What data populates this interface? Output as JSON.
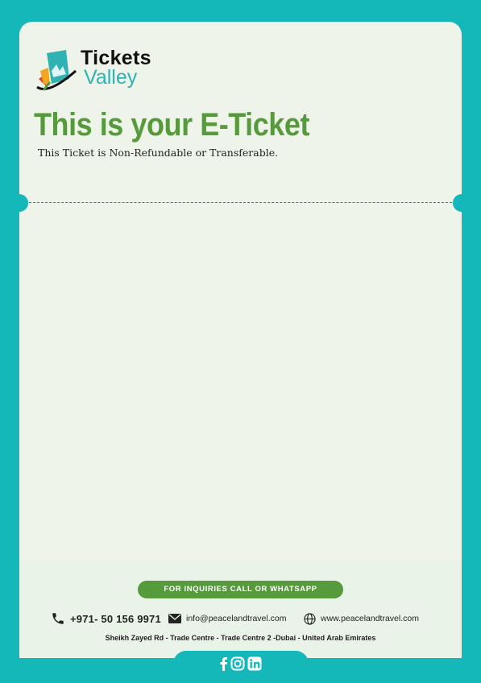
{
  "brand": {
    "name_line1": "Tickets",
    "name_line2": "Valley",
    "colors": {
      "teal": "#14b8b8",
      "green": "#559a3b",
      "paper": "#eef4ea"
    }
  },
  "ticket": {
    "headline": "This is your E-Ticket",
    "notice": "This Ticket is Non-Refundable or Transferable."
  },
  "footer": {
    "inquiry_label": "FOR INQUIRIES CALL OR WHATSAPP",
    "phone": "+971- 50 156 9971",
    "email": "info@peacelandtravel.com",
    "website": "www.peacelandtravel.com",
    "address": "Sheikh Zayed Rd - Trade Centre - Trade Centre 2 -Dubai - United Arab Emirates",
    "icons": [
      "phone-icon",
      "mail-icon",
      "globe-icon"
    ]
  },
  "social": {
    "icons": [
      "facebook-icon",
      "instagram-icon",
      "linkedin-icon"
    ]
  }
}
